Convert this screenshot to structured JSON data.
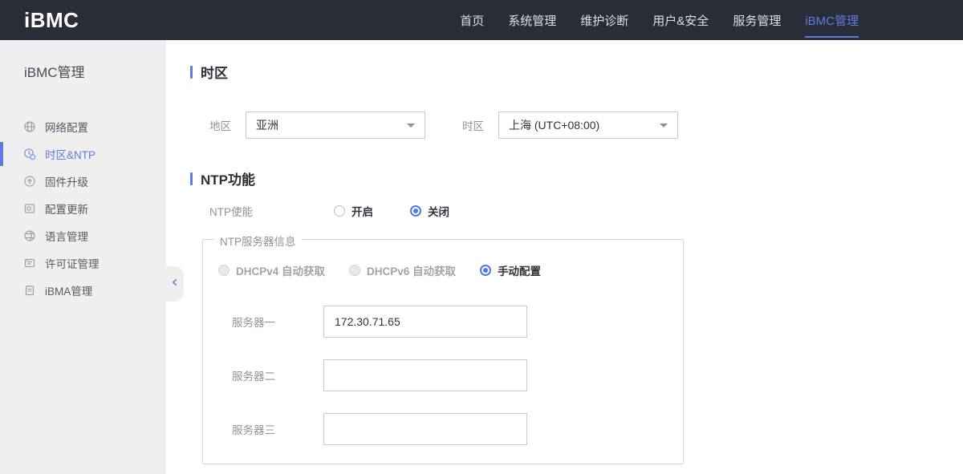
{
  "topbar": {
    "logo": "iBMC",
    "nav": [
      {
        "label": "首页",
        "active": false
      },
      {
        "label": "系统管理",
        "active": false
      },
      {
        "label": "维护诊断",
        "active": false
      },
      {
        "label": "用户&安全",
        "active": false
      },
      {
        "label": "服务管理",
        "active": false
      },
      {
        "label": "iBMC管理",
        "active": true
      }
    ]
  },
  "sidebar": {
    "title": "iBMC管理",
    "items": [
      {
        "label": "网络配置",
        "icon": "network-globe-icon",
        "active": false
      },
      {
        "label": "时区&NTP",
        "icon": "timezone-clock-icon",
        "active": true
      },
      {
        "label": "固件升级",
        "icon": "firmware-upgrade-icon",
        "active": false
      },
      {
        "label": "配置更新",
        "icon": "config-update-icon",
        "active": false
      },
      {
        "label": "语言管理",
        "icon": "language-globe-icon",
        "active": false
      },
      {
        "label": "许可证管理",
        "icon": "license-icon",
        "active": false
      },
      {
        "label": "iBMA管理",
        "icon": "ibma-clipboard-icon",
        "active": false
      }
    ]
  },
  "main": {
    "timezone_section": {
      "title": "时区",
      "region": {
        "label": "地区",
        "value": "亚洲"
      },
      "zone": {
        "label": "时区",
        "value": "上海 (UTC+08:00)"
      }
    },
    "ntp_section": {
      "title": "NTP功能",
      "enable": {
        "label": "NTP使能",
        "options": [
          {
            "label": "开启",
            "selected": false
          },
          {
            "label": "关闭",
            "selected": true
          }
        ]
      },
      "server_group": {
        "legend": "NTP服务器信息",
        "modes": [
          {
            "label": "DHCPv4 自动获取",
            "state": "disabled"
          },
          {
            "label": "DHCPv6 自动获取",
            "state": "disabled"
          },
          {
            "label": "手动配置",
            "state": "selected"
          }
        ],
        "servers": [
          {
            "label": "服务器一",
            "value": "172.30.71.65"
          },
          {
            "label": "服务器二",
            "value": ""
          },
          {
            "label": "服务器三",
            "value": ""
          }
        ]
      }
    }
  },
  "colors": {
    "accent": "#5e7ce0",
    "radio_blue": "#4e79e5",
    "topbar_bg": "#2a2e39",
    "sidebar_bg": "#efefef"
  }
}
